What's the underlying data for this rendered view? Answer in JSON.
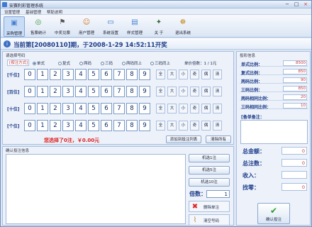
{
  "window": {
    "title": "安赛利彩管理系统",
    "minimize": "−",
    "maximize": "□",
    "close": "×"
  },
  "menu": [
    "设置管理",
    "基础管理",
    "帮助说明"
  ],
  "toolbar": [
    {
      "label": "采购管理",
      "icon": "inbox-icon",
      "glyph": "▣",
      "color": "#4a7fcf"
    },
    {
      "label": "售票统计",
      "icon": "chart-icon",
      "glyph": "◎",
      "color": "#3a9a3a"
    },
    {
      "label": "中奖兑票",
      "icon": "flag-icon",
      "glyph": "⚑",
      "color": "#555"
    },
    {
      "label": "用户管理",
      "icon": "users-icon",
      "glyph": "☺",
      "color": "#d07a2a"
    },
    {
      "label": "系统设置",
      "icon": "monitor-icon",
      "glyph": "▭",
      "color": "#2a6fc4"
    },
    {
      "label": "样式管理",
      "icon": "window-icon",
      "glyph": "▤",
      "color": "#4a7fcf"
    },
    {
      "label": "关 于",
      "icon": "info-icon",
      "glyph": "✦",
      "color": "#3a6a3a"
    },
    {
      "label": "退出系统",
      "icon": "exit-icon",
      "glyph": "☸",
      "color": "#c78a1a"
    }
  ],
  "banner": {
    "text": "当前第[20080110]期，于2008-1-29 14:52:11开奖"
  },
  "pick": {
    "title": "请选择号码",
    "mode_label": "[按注方式]",
    "modes": [
      "单式",
      "复式",
      "两码",
      "三码",
      "两码同上",
      "三码同上"
    ],
    "unit_price": "单价倍数：1 / 1元",
    "rows": [
      {
        "label": "[千位]",
        "digits": [
          "0",
          "1",
          "2",
          "3",
          "4",
          "5",
          "6",
          "7",
          "8",
          "9"
        ]
      },
      {
        "label": "[百位]",
        "digits": [
          "0",
          "1",
          "2",
          "3",
          "4",
          "5",
          "6",
          "7",
          "8",
          "9"
        ]
      },
      {
        "label": "[十位]",
        "digits": [
          "0",
          "1",
          "2",
          "3",
          "4",
          "5",
          "6",
          "7",
          "8",
          "9"
        ]
      },
      {
        "label": "[个位]",
        "digits": [
          "0",
          "1",
          "2",
          "3",
          "4",
          "5",
          "6",
          "7",
          "8",
          "9"
        ]
      }
    ],
    "funcs": [
      "全",
      "大",
      "小",
      "奇",
      "偶",
      "清"
    ],
    "selected_msg": "您选择了0注，￥0.00元",
    "add_button": "添加到投注列表",
    "clear_button": "清除所有"
  },
  "confirm": {
    "title": "确认投注信息",
    "machine_buttons": [
      "机选1注",
      "机选5注",
      "机选10注"
    ],
    "multiplier_label": "倍数：",
    "multiplier_value": "1",
    "delete_label": "删除单注",
    "clear_label": "清空号码"
  },
  "stats": {
    "title": "投彩信息",
    "rows": [
      {
        "k": "单式比例：",
        "v": "8500"
      },
      {
        "k": "复式比例：",
        "v": "850"
      },
      {
        "k": "两码比例：",
        "v": "90"
      },
      {
        "k": "三码比例：",
        "v": "850"
      },
      {
        "k": "两码相同比例：",
        "v": "20"
      },
      {
        "k": "三码相同比例：",
        "v": "10"
      }
    ],
    "note_label": "[备单备注：",
    "totals": [
      {
        "k": "总金额：",
        "v": "0"
      },
      {
        "k": "总注数：",
        "v": "0"
      },
      {
        "k": "收入：",
        "v": ""
      },
      {
        "k": "找零：",
        "v": "0"
      }
    ],
    "confirm_button": "确认投注"
  }
}
